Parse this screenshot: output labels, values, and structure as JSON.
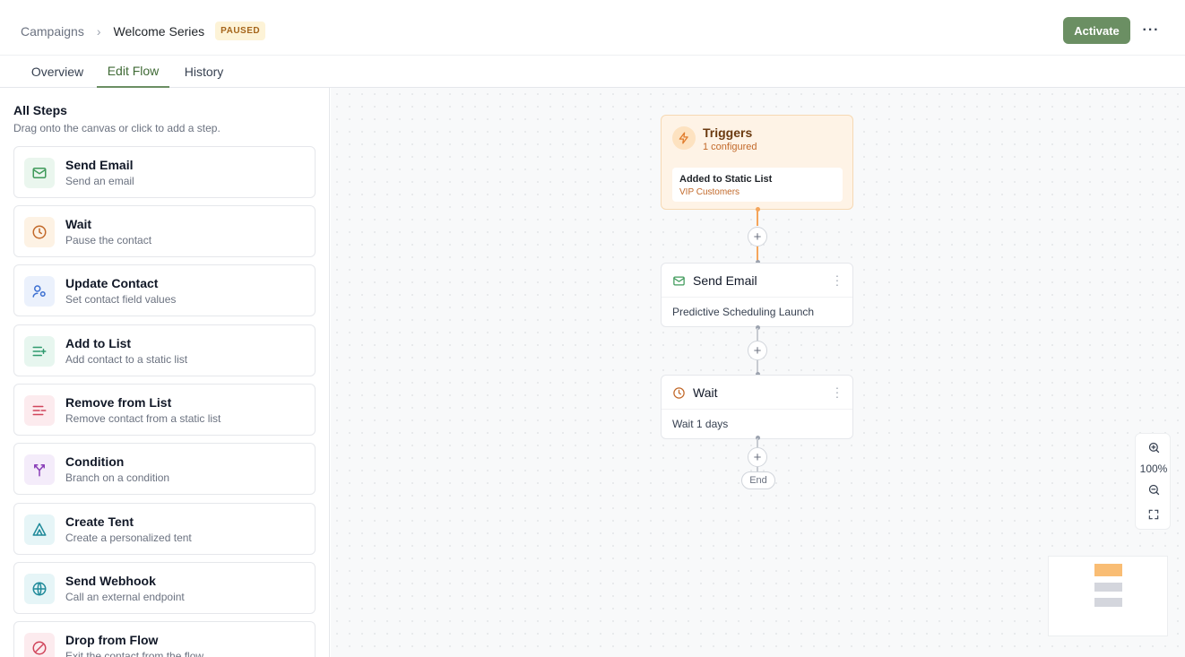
{
  "header": {
    "breadcrumb_root": "Campaigns",
    "breadcrumb_sep": "›",
    "campaign_name": "Welcome Series",
    "status_badge": "PAUSED",
    "activate_label": "Activate",
    "more_label": "···"
  },
  "tabs": [
    {
      "label": "Overview",
      "active": false
    },
    {
      "label": "Edit Flow",
      "active": true
    },
    {
      "label": "History",
      "active": false
    }
  ],
  "sidebar": {
    "title": "All Steps",
    "subtitle": "Drag onto the canvas or click to add a step.",
    "steps": [
      {
        "name": "Send Email",
        "desc": "Send an email",
        "icon": "mail-icon",
        "color": "#3f9a5a",
        "bg": "#eaf6ee"
      },
      {
        "name": "Wait",
        "desc": "Pause the contact",
        "icon": "clock-icon",
        "color": "#c2692a",
        "bg": "#fdf2e4"
      },
      {
        "name": "Update Contact",
        "desc": "Set contact field values",
        "icon": "user-settings-icon",
        "color": "#3b6fd1",
        "bg": "#ebf1fc"
      },
      {
        "name": "Add to List",
        "desc": "Add contact to a static list",
        "icon": "list-add-icon",
        "color": "#2f9a6e",
        "bg": "#e7f6ef"
      },
      {
        "name": "Remove from List",
        "desc": "Remove contact from a static list",
        "icon": "list-remove-icon",
        "color": "#d0455b",
        "bg": "#fcebee"
      },
      {
        "name": "Condition",
        "desc": "Branch on a condition",
        "icon": "branch-icon",
        "color": "#8a3fb8",
        "bg": "#f4ecfa"
      },
      {
        "name": "Create Tent",
        "desc": "Create a personalized tent",
        "icon": "tent-icon",
        "color": "#1f8a9a",
        "bg": "#e6f5f7"
      },
      {
        "name": "Send Webhook",
        "desc": "Call an external endpoint",
        "icon": "globe-icon",
        "color": "#1f8a9a",
        "bg": "#e6f5f7"
      },
      {
        "name": "Drop from Flow",
        "desc": "Exit the contact from the flow",
        "icon": "ban-icon",
        "color": "#d0455b",
        "bg": "#fcebee"
      }
    ]
  },
  "flow": {
    "trigger": {
      "title": "Triggers",
      "count": "1 configured",
      "item_title": "Added to Static List",
      "item_sub": "VIP Customers"
    },
    "nodes": [
      {
        "title": "Send Email",
        "body": "Predictive Scheduling Launch",
        "icon": "mail-icon"
      },
      {
        "title": "Wait",
        "body": "Wait 1 days",
        "icon": "clock-icon"
      }
    ],
    "add_label": "+",
    "end_label": "End"
  },
  "zoom": {
    "level": "100%"
  },
  "colors": {
    "accent": "#6b8f63",
    "trigger_orange": "#f5a55b",
    "minimap_trigger": "#f9bd74",
    "minimap_node": "#d4d6dd"
  }
}
